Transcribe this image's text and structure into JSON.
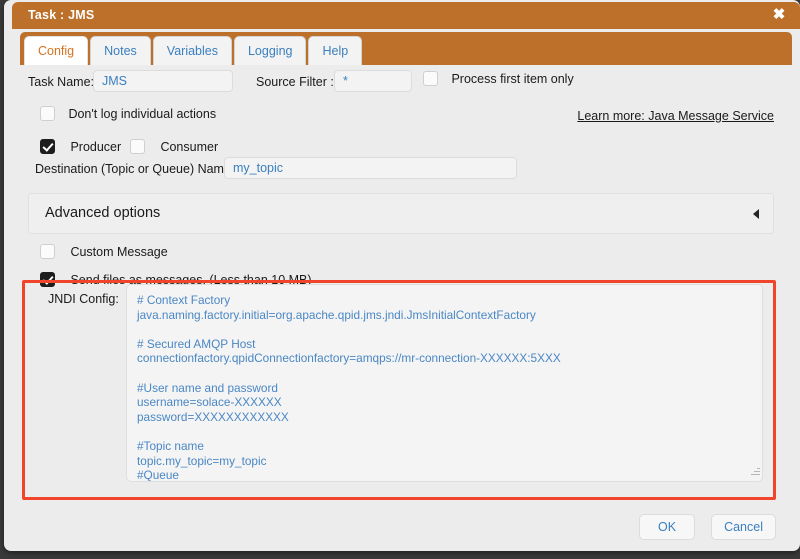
{
  "window": {
    "title": "Task : JMS",
    "close_label": "✖",
    "accent_color": "#bd702a",
    "highlight_color": "#f0452a",
    "link_color": "#3a7fbf"
  },
  "tabs": [
    {
      "label": "Config",
      "active": true
    },
    {
      "label": "Notes",
      "active": false
    },
    {
      "label": "Variables",
      "active": false
    },
    {
      "label": "Logging",
      "active": false
    },
    {
      "label": "Help",
      "active": false
    }
  ],
  "form": {
    "task_name_label": "Task Name:",
    "task_name_value": "JMS",
    "task_name_placeholder": "Task Name",
    "source_filter_label": "Source Filter :",
    "source_filter_value": "*",
    "source_filter_placeholder": "*",
    "process_first_item_label": "Process first item only",
    "process_first_item_checked": false,
    "dont_log_label": "Don't log individual actions",
    "dont_log_checked": false,
    "producer_label": "Producer",
    "producer_checked": true,
    "consumer_label": "Consumer",
    "consumer_checked": false,
    "destination_label": "Destination (Topic or Queue) Name:",
    "destination_value": "my_topic",
    "destination_placeholder": "Destination name",
    "learn_more_link": "Learn more: Java Message Service"
  },
  "advanced": {
    "title": "Advanced options",
    "collapse_icon": "triangle-left-icon",
    "custom_message_label": "Custom Message",
    "custom_message_checked": false,
    "send_files_label": "Send files as messages.  (Less than 10 MB)",
    "send_files_checked": true,
    "jndi_label": "JNDI Config:",
    "jndi_value": "# Context Factory\njava.naming.factory.initial=org.apache.qpid.jms.jndi.JmsInitialContextFactory\n\n# Secured AMQP Host\nconnectionfactory.qpidConnectionfactory=amqps://mr-connection-XXXXXX:5XXX\n\n#User name and password\nusername=solace-XXXXXX\npassword=XXXXXXXXXXXX\n\n#Topic name\ntopic.my_topic=my_topic\n#Queue\nqueue.my_quee=my_quee",
    "jndi_placeholder": "JNDI configuration properties"
  },
  "footer": {
    "ok_label": "OK",
    "cancel_label": "Cancel"
  }
}
